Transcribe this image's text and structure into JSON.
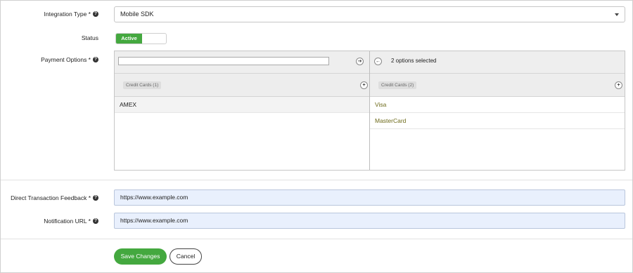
{
  "integration_type": {
    "label": "Integration Type *",
    "value": "Mobile SDK"
  },
  "status": {
    "label": "Status",
    "toggle_label": "Active"
  },
  "payment_options": {
    "label": "Payment Options *",
    "filter_placeholder": "",
    "available": {
      "group_tag": "Credit Cards (1)",
      "items": [
        "AMEX"
      ]
    },
    "selected": {
      "count_text": "2 options selected",
      "group_tag": "Credit Cards (2)",
      "items": [
        "Visa",
        "MasterCard"
      ]
    }
  },
  "direct_feedback": {
    "label": "Direct Transaction Feedback *",
    "value": "https://www.example.com"
  },
  "notification_url": {
    "label": "Notification URL *",
    "value": "https://www.example.com"
  },
  "buttons": {
    "save": "Save Changes",
    "cancel": "Cancel"
  },
  "colors": {
    "accent_green": "#44a83f",
    "input_bg": "#e9f0fd",
    "selected_text": "#6d6a1a"
  },
  "icons": {
    "help": "question-circle-icon",
    "move_right": "arrow-right-circle-icon",
    "move_left": "arrow-left-circle-icon",
    "add": "plus-circle-icon",
    "caret": "caret-down-icon"
  }
}
